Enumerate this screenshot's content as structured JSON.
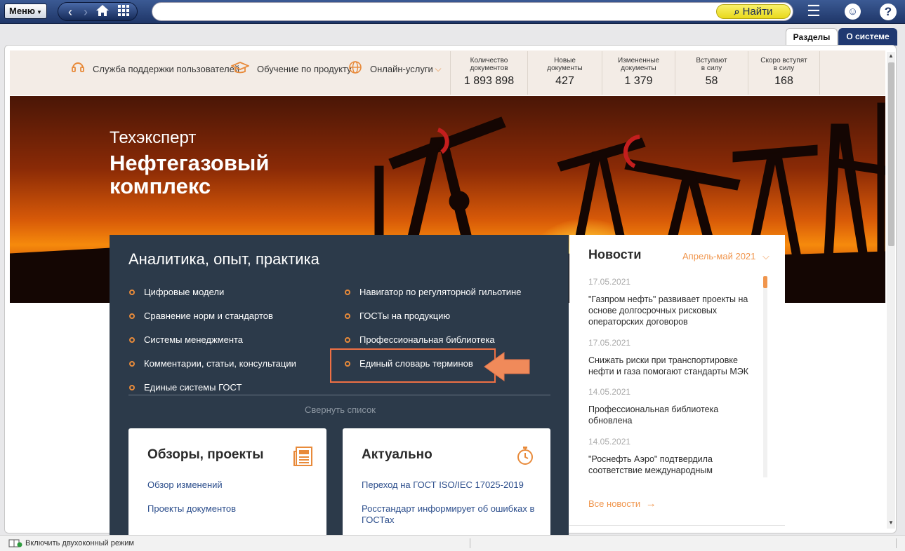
{
  "toolbar": {
    "menu_label": "Меню",
    "search_placeholder": "",
    "find_label": "Найти"
  },
  "tabs": [
    {
      "label": "Разделы"
    },
    {
      "label": "О системе"
    }
  ],
  "header": {
    "links": [
      {
        "label": "Служба поддержки пользователей",
        "icon": "headset-icon"
      },
      {
        "label": "Обучение по продукту",
        "icon": "graduation-cap-icon"
      },
      {
        "label": "Онлайн-услуги",
        "icon": "globe-icon"
      }
    ],
    "stats": [
      {
        "label_line1": "Количество",
        "label_line2": "документов",
        "value": "1 893 898"
      },
      {
        "label_line1": "Новые",
        "label_line2": "документы",
        "value": "427"
      },
      {
        "label_line1": "Измененные",
        "label_line2": "документы",
        "value": "1 379"
      },
      {
        "label_line1": "Вступают",
        "label_line2": "в силу",
        "value": "58"
      },
      {
        "label_line1": "Скоро вступят",
        "label_line2": "в силу",
        "value": "168"
      }
    ]
  },
  "banner": {
    "subtitle": "Техэксперт",
    "title": "Нефтегазовый комплекс"
  },
  "panel": {
    "title": "Аналитика, опыт, практика",
    "left_items": [
      "Цифровые модели",
      "Сравнение норм и стандартов",
      "Системы менеджмента",
      "Комментарии, статьи, консультации",
      "Единые системы ГОСТ"
    ],
    "right_items": [
      "Навигатор по регуляторной гильотине",
      "ГОСТы на продукцию",
      "Профессиональная библиотека",
      "Единый словарь терминов"
    ],
    "collapse_label": "Свернуть список"
  },
  "cards": [
    {
      "title": "Обзоры, проекты",
      "icon": "newspaper-icon",
      "links": [
        "Обзор изменений",
        "Проекты документов"
      ]
    },
    {
      "title": "Актуально",
      "icon": "stopwatch-icon",
      "links": [
        "Переход на ГОСТ ISO/IEC 17025-2019",
        "Росстандарт информирует об ошибках в ГОСТах"
      ]
    }
  ],
  "news": {
    "title": "Новости",
    "period": "Апрель-май 2021",
    "items": [
      {
        "date": "17.05.2021",
        "text": "\"Газпром нефть\" развивает проекты на основе долгосрочных рисковых операторских договоров"
      },
      {
        "date": "17.05.2021",
        "text": "Снижать риски при транспортировке нефти и газа помогают стандарты МЭК"
      },
      {
        "date": "14.05.2021",
        "text": "Профессиональная библиотека обновлена"
      },
      {
        "date": "14.05.2021",
        "text": "\"Роснефть Аэро\" подтвердила соответствие международным"
      }
    ],
    "all_news_label": "Все новости"
  },
  "status": {
    "text": "Включить двухоконный режим"
  },
  "colors": {
    "accent": "#e88a3a",
    "nav_dark": "#203971",
    "panel_bg": "#2c3a4a",
    "highlight": "#ef7044",
    "find_btn": "#f3e33b"
  }
}
